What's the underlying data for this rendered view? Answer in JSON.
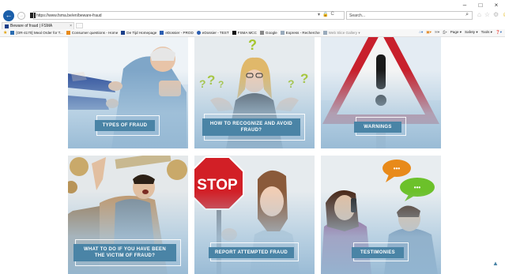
{
  "browser": {
    "url": "https://www.fsma.be/en/beware-fraud",
    "search_placeholder": "Search...",
    "tab_title": "Beware of fraud | FSMA",
    "tab_close": "×",
    "back": "←",
    "forward": "→",
    "win_controls": {
      "minimize": "–",
      "maximize": "□",
      "close": "×"
    },
    "addr_tools": [
      "▾",
      "🔒",
      "C"
    ],
    "favorites": [
      "[OR-4170] Meal Order for T...",
      "Consumer questions - Home",
      "De Tijd Homepage",
      "eDossier - PROD",
      "eDossier - TEST",
      "FSMA MCC",
      "Google",
      "Express - Recherche",
      "Web Slice Gallery ▾"
    ],
    "fav_tools": [
      "Page ▾",
      "Safety ▾",
      "Tools ▾"
    ]
  },
  "cards": [
    {
      "label": "TYPES OF FRAUD"
    },
    {
      "label": "HOW TO RECOGNIZE AND AVOID FRAUD?"
    },
    {
      "label": "WARNINGS"
    },
    {
      "label": "WHAT TO DO IF YOU HAVE BEEN THE VICTIM OF FRAUD?"
    },
    {
      "label": "REPORT ATTEMPTED FRAUD"
    },
    {
      "label": "TESTIMONIES"
    }
  ],
  "stop_sign_text": "STOP",
  "question_marks": "?",
  "speech_dots": "•••",
  "warning_mark": "!",
  "scroll_top_glyph": "▲",
  "colors": {
    "accent": "#4a84a6",
    "browser_blue": "#1b5faa",
    "warning_red": "#c8202c"
  }
}
